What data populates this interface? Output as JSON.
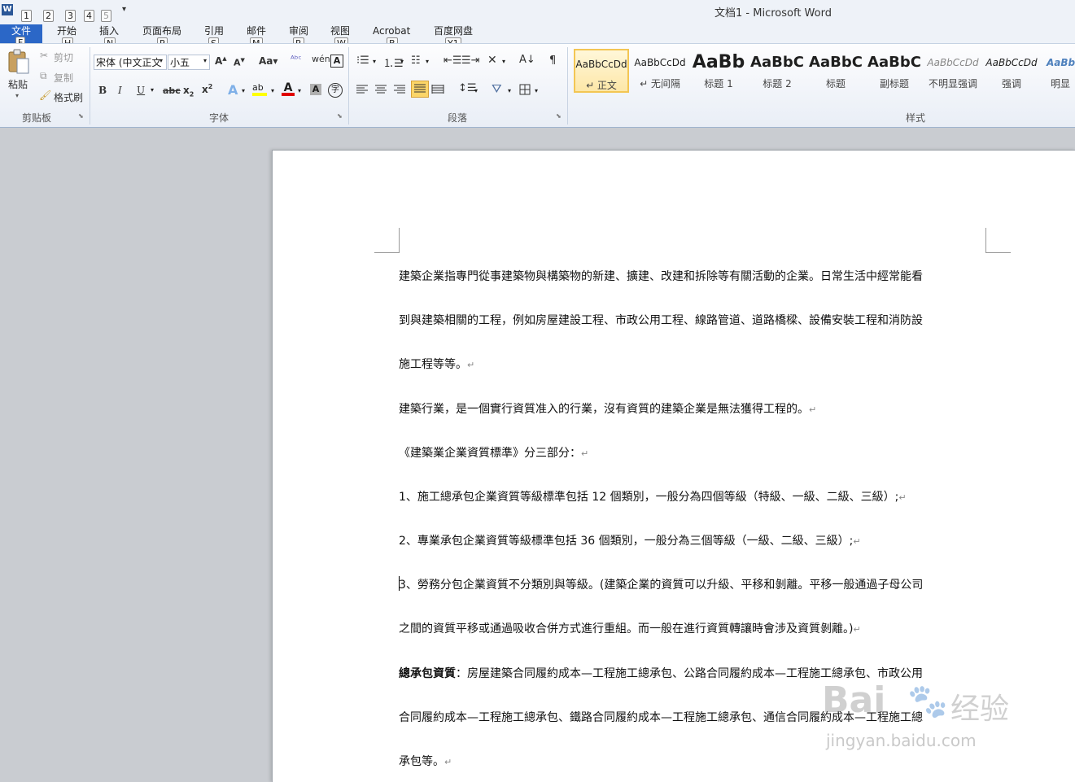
{
  "window": {
    "title": "文档1  -  Microsoft Word"
  },
  "quick_access": {
    "keytips": [
      "1",
      "2",
      "3",
      "4",
      "5"
    ]
  },
  "tabs": [
    {
      "label": "文件",
      "keytip": "F"
    },
    {
      "label": "开始",
      "keytip": "H"
    },
    {
      "label": "插入",
      "keytip": "N"
    },
    {
      "label": "页面布局",
      "keytip": "P"
    },
    {
      "label": "引用",
      "keytip": "S"
    },
    {
      "label": "邮件",
      "keytip": "M"
    },
    {
      "label": "审阅",
      "keytip": "R"
    },
    {
      "label": "视图",
      "keytip": "W"
    },
    {
      "label": "Acrobat",
      "keytip": "B"
    },
    {
      "label": "百度网盘",
      "keytip": "Y1"
    }
  ],
  "ribbon": {
    "clipboard": {
      "group_label": "剪贴板",
      "paste": "粘贴",
      "cut": "剪切",
      "copy": "复制",
      "format_painter": "格式刷"
    },
    "font": {
      "group_label": "字体",
      "font_name": "宋体 (中文正文",
      "font_size": "小五"
    },
    "paragraph": {
      "group_label": "段落"
    },
    "styles": {
      "group_label": "样式",
      "items": [
        {
          "preview": "AaBbCcDd",
          "name": "↵ 正文"
        },
        {
          "preview": "AaBbCcDd",
          "name": "↵ 无间隔"
        },
        {
          "preview": "AaBb",
          "name": "标题 1"
        },
        {
          "preview": "AaBbC",
          "name": "标题 2"
        },
        {
          "preview": "AaBbC",
          "name": "标题"
        },
        {
          "preview": "AaBbC",
          "name": "副标题"
        },
        {
          "preview": "AaBbCcDd",
          "name": "不明显强调"
        },
        {
          "preview": "AaBbCcDd",
          "name": "强调"
        },
        {
          "preview": "AaBb",
          "name": "明显强"
        }
      ]
    }
  },
  "document": {
    "lines": [
      "建築企業指專門從事建築物與構築物的新建、擴建、改建和拆除等有關活動的企業。日常生活中經常能看",
      "到與建築相關的工程，例如房屋建設工程、市政公用工程、線路管道、道路橋樑、設備安裝工程和消防設",
      "施工程等等。",
      "建築行業，是一個實行資質准入的行業，沒有資質的建築企業是無法獲得工程的。",
      "《建築業企業資質標準》分三部分：",
      "1、施工總承包企業資質等級標準包括 12 個類別，一般分為四個等級（特級、一級、二級、三級）;",
      "2、專業承包企業資質等級標準包括 36 個類別，一般分為三個等級（一級、二級、三級）;",
      "3、勞務分包企業資質不分類別與等級。(建築企業的資質可以升級、平移和剝離。平移一般通過子母公司",
      "之間的資質平移或通過吸收合併方式進行重組。而一般在進行資質轉讓時會涉及資質剝離。)",
      "：房屋建築合同履約成本—工程施工總承包、公路合同履約成本—工程施工總承包、市政公用",
      "合同履約成本—工程施工總承包、鐵路合同履約成本—工程施工總承包、通信合同履約成本—工程施工總",
      "承包等。"
    ],
    "bold_prefix": "總承包資質",
    "para_mark": "↵"
  },
  "watermark": {
    "brand": "Bai",
    "text": "经验",
    "url": "jingyan.baidu.com"
  }
}
